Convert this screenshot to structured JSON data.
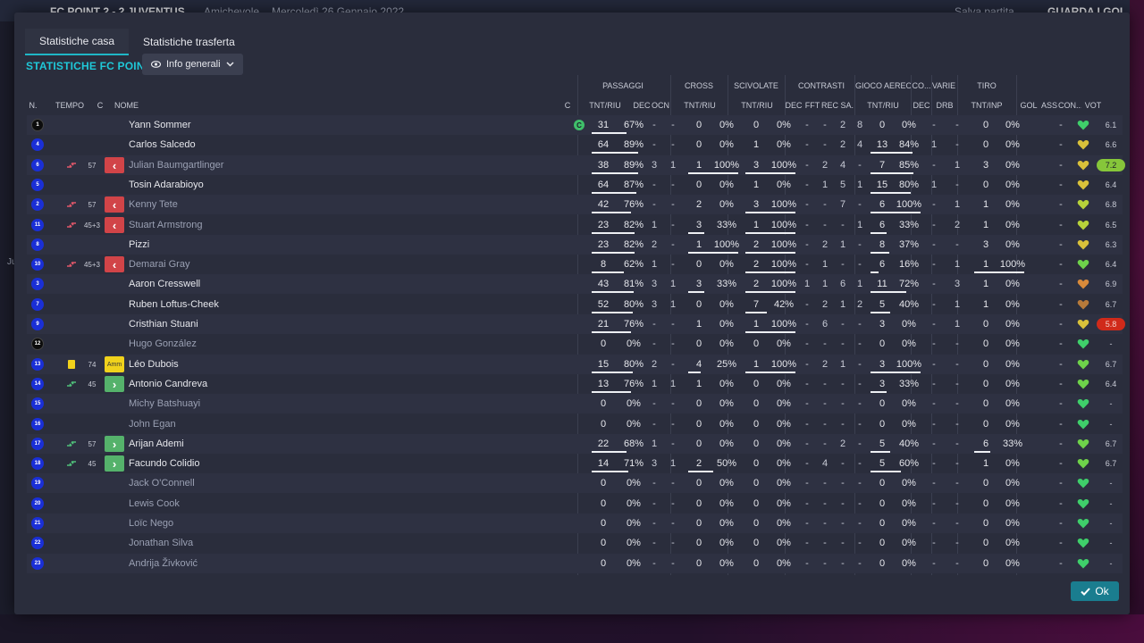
{
  "background": {
    "match": "FC POINT  2 - 2  JUVENTUS",
    "type": "Amichevole",
    "date": "Mercoledì 26 Gennaio 2022",
    "save": "Salva partita",
    "watch": "GUARDA I GOL",
    "side": "Ju"
  },
  "tabs": [
    {
      "label": "Statistiche casa"
    },
    {
      "label": "Statistiche trasferta"
    }
  ],
  "team_title": "STATISTICHE FC POINT",
  "info_btn": "Info generali",
  "headers": {
    "n": "N.",
    "tempo": "TEMPO",
    "c": "C",
    "nome": "NOME",
    "c2": "C",
    "passaggi": "PASSAGGI",
    "cross": "CROSS",
    "scivolate": "SCIVOLATE",
    "contrasti": "CONTRASTI",
    "gioco_aereo": "GIOCO AEREO",
    "co": "CO...",
    "varie": "VARIE",
    "tiro": "TIRO",
    "tnt_riu": "TNT/RIU",
    "dec": "DEC",
    "ocn": "OCN",
    "fft": "FFT",
    "rec_sa": "REC SA...",
    "drb": "DRB",
    "tnt_inp": "TNT/INP",
    "gol": "GOL",
    "ass": "ASS",
    "con": "CON...",
    "vot": "VOT"
  },
  "players": [
    {
      "n": "1",
      "gk": true,
      "name": "Yann Sommer",
      "dim": false,
      "mins": "",
      "sub": "",
      "role": "",
      "cap": true,
      "p": [
        "31",
        "67%"
      ],
      "pdec": "-",
      "pocn": "-",
      "cr": [
        "0",
        "0%"
      ],
      "sc": [
        "0",
        "0%"
      ],
      "ct": [
        "-",
        "-",
        "2",
        "8"
      ],
      "ga": [
        "0",
        "0%"
      ],
      "co": "-",
      "drb": "-",
      "tiro": [
        "0",
        "0%"
      ],
      "gol": "",
      "ass": "-",
      "vot": "6.1",
      "vcls": "",
      "heart": "#3fcf6a"
    },
    {
      "n": "4",
      "gk": false,
      "name": "Carlos Salcedo",
      "dim": false,
      "mins": "",
      "sub": "",
      "role": "",
      "cap": false,
      "p": [
        "64",
        "89%"
      ],
      "pdec": "-",
      "pocn": "-",
      "cr": [
        "0",
        "0%"
      ],
      "sc": [
        "1",
        "0%"
      ],
      "ct": [
        "-",
        "-",
        "2",
        "4"
      ],
      "ga": [
        "13",
        "84%"
      ],
      "co": "1",
      "drb": "-",
      "tiro": [
        "0",
        "0%"
      ],
      "gol": "",
      "ass": "-",
      "vot": "6.6",
      "vcls": "",
      "heart": "#d9c13a"
    },
    {
      "n": "6",
      "gk": false,
      "name": "Julian Baumgartlinger",
      "dim": true,
      "mins": "57",
      "sub": "out",
      "role": "out",
      "cap": false,
      "p": [
        "38",
        "89%"
      ],
      "pdec": "3",
      "pocn": "1",
      "cr": [
        "1",
        "100%"
      ],
      "sc": [
        "3",
        "100%"
      ],
      "ct": [
        "-",
        "2",
        "4",
        "-"
      ],
      "ga": [
        "7",
        "85%"
      ],
      "co": "-",
      "drb": "1",
      "tiro": [
        "3",
        "0%"
      ],
      "gol": "",
      "ass": "-",
      "vot": "7.2",
      "vcls": "good",
      "heart": "#d9c13a"
    },
    {
      "n": "5",
      "gk": false,
      "name": "Tosin Adarabioyo",
      "dim": false,
      "mins": "",
      "sub": "",
      "role": "",
      "cap": false,
      "p": [
        "64",
        "87%"
      ],
      "pdec": "-",
      "pocn": "-",
      "cr": [
        "0",
        "0%"
      ],
      "sc": [
        "1",
        "0%"
      ],
      "ct": [
        "-",
        "1",
        "5",
        "1"
      ],
      "ga": [
        "15",
        "80%"
      ],
      "co": "1",
      "drb": "-",
      "tiro": [
        "0",
        "0%"
      ],
      "gol": "",
      "ass": "-",
      "vot": "6.4",
      "vcls": "",
      "heart": "#d9c13a"
    },
    {
      "n": "2",
      "gk": false,
      "name": "Kenny Tete",
      "dim": true,
      "mins": "57",
      "sub": "out",
      "role": "out",
      "cap": false,
      "p": [
        "42",
        "76%"
      ],
      "pdec": "-",
      "pocn": "-",
      "cr": [
        "2",
        "0%"
      ],
      "sc": [
        "3",
        "100%"
      ],
      "ct": [
        "-",
        "-",
        "7",
        "-"
      ],
      "ga": [
        "6",
        "100%"
      ],
      "co": "-",
      "drb": "1",
      "tiro": [
        "1",
        "0%"
      ],
      "gol": "",
      "ass": "-",
      "vot": "6.8",
      "vcls": "",
      "heart": "#b7d23a"
    },
    {
      "n": "11",
      "gk": false,
      "name": "Stuart Armstrong",
      "dim": true,
      "mins": "45+3",
      "sub": "out",
      "role": "out",
      "cap": false,
      "p": [
        "23",
        "82%"
      ],
      "pdec": "1",
      "pocn": "-",
      "cr": [
        "3",
        "33%"
      ],
      "sc": [
        "1",
        "100%"
      ],
      "ct": [
        "-",
        "-",
        "-",
        "1"
      ],
      "ga": [
        "6",
        "33%"
      ],
      "co": "-",
      "drb": "2",
      "tiro": [
        "1",
        "0%"
      ],
      "gol": "",
      "ass": "-",
      "vot": "6.5",
      "vcls": "",
      "heart": "#b7d23a"
    },
    {
      "n": "8",
      "gk": false,
      "name": "Pizzi",
      "dim": false,
      "mins": "",
      "sub": "",
      "role": "",
      "cap": false,
      "p": [
        "23",
        "82%"
      ],
      "pdec": "2",
      "pocn": "-",
      "cr": [
        "1",
        "100%"
      ],
      "sc": [
        "2",
        "100%"
      ],
      "ct": [
        "-",
        "2",
        "1",
        "-"
      ],
      "ga": [
        "8",
        "37%"
      ],
      "co": "-",
      "drb": "-",
      "tiro": [
        "3",
        "0%"
      ],
      "gol": "",
      "ass": "-",
      "vot": "6.3",
      "vcls": "",
      "heart": "#d9c13a"
    },
    {
      "n": "10",
      "gk": false,
      "name": "Demarai Gray",
      "dim": true,
      "mins": "45+3",
      "sub": "out",
      "role": "out",
      "cap": false,
      "p": [
        "8",
        "62%"
      ],
      "pdec": "1",
      "pocn": "-",
      "cr": [
        "0",
        "0%"
      ],
      "sc": [
        "2",
        "100%"
      ],
      "ct": [
        "-",
        "1",
        "-",
        "-"
      ],
      "ga": [
        "6",
        "16%"
      ],
      "co": "-",
      "drb": "1",
      "tiro": [
        "1",
        "100%"
      ],
      "gol": "",
      "ass": "-",
      "vot": "6.4",
      "vcls": "",
      "heart": "#6ed24a"
    },
    {
      "n": "3",
      "gk": false,
      "name": "Aaron Cresswell",
      "dim": false,
      "mins": "",
      "sub": "",
      "role": "",
      "cap": false,
      "p": [
        "43",
        "81%"
      ],
      "pdec": "3",
      "pocn": "1",
      "cr": [
        "3",
        "33%"
      ],
      "sc": [
        "2",
        "100%"
      ],
      "ct": [
        "1",
        "1",
        "6",
        "1"
      ],
      "ga": [
        "11",
        "72%"
      ],
      "co": "-",
      "drb": "3",
      "tiro": [
        "1",
        "0%"
      ],
      "gol": "",
      "ass": "-",
      "vot": "6.9",
      "vcls": "",
      "heart": "#d98a3a"
    },
    {
      "n": "7",
      "gk": false,
      "name": "Ruben Loftus-Cheek",
      "dim": false,
      "mins": "",
      "sub": "",
      "role": "",
      "cap": false,
      "p": [
        "52",
        "80%"
      ],
      "pdec": "3",
      "pocn": "1",
      "cr": [
        "0",
        "0%"
      ],
      "sc": [
        "7",
        "42%"
      ],
      "ct": [
        "-",
        "2",
        "1",
        "2"
      ],
      "ga": [
        "5",
        "40%"
      ],
      "co": "-",
      "drb": "1",
      "tiro": [
        "1",
        "0%"
      ],
      "gol": "",
      "ass": "-",
      "vot": "6.7",
      "vcls": "",
      "heart": "#b77a3a"
    },
    {
      "n": "9",
      "gk": false,
      "name": "Cristhian Stuani",
      "dim": false,
      "mins": "",
      "sub": "",
      "role": "",
      "cap": false,
      "p": [
        "21",
        "76%"
      ],
      "pdec": "-",
      "pocn": "-",
      "cr": [
        "1",
        "0%"
      ],
      "sc": [
        "1",
        "100%"
      ],
      "ct": [
        "-",
        "6",
        "-",
        "-"
      ],
      "ga": [
        "3",
        "0%"
      ],
      "co": "-",
      "drb": "1",
      "tiro": [
        "0",
        "0%"
      ],
      "gol": "",
      "ass": "-",
      "vot": "5.8",
      "vcls": "bad",
      "heart": "#d9c13a"
    },
    {
      "n": "12",
      "gk": true,
      "name": "Hugo González",
      "dim": true,
      "mins": "",
      "sub": "",
      "role": "",
      "cap": false,
      "p": [
        "0",
        "0%"
      ],
      "pdec": "-",
      "pocn": "-",
      "cr": [
        "0",
        "0%"
      ],
      "sc": [
        "0",
        "0%"
      ],
      "ct": [
        "-",
        "-",
        "-",
        "-"
      ],
      "ga": [
        "0",
        "0%"
      ],
      "co": "-",
      "drb": "-",
      "tiro": [
        "0",
        "0%"
      ],
      "gol": "",
      "ass": "-",
      "vot": "-",
      "vcls": "",
      "heart": "#3fcf6a"
    },
    {
      "n": "13",
      "gk": false,
      "name": "Léo Dubois",
      "dim": false,
      "mins": "74",
      "sub": "yellow",
      "role": "amm",
      "cap": false,
      "p": [
        "15",
        "80%"
      ],
      "pdec": "2",
      "pocn": "-",
      "cr": [
        "4",
        "25%"
      ],
      "sc": [
        "1",
        "100%"
      ],
      "ct": [
        "-",
        "2",
        "1",
        "-"
      ],
      "ga": [
        "3",
        "100%"
      ],
      "co": "-",
      "drb": "-",
      "tiro": [
        "0",
        "0%"
      ],
      "gol": "",
      "ass": "-",
      "vot": "6.7",
      "vcls": "",
      "heart": "#6ed24a"
    },
    {
      "n": "14",
      "gk": false,
      "name": "Antonio Candreva",
      "dim": false,
      "mins": "45",
      "sub": "in",
      "role": "in",
      "cap": false,
      "p": [
        "13",
        "76%"
      ],
      "pdec": "1",
      "pocn": "1",
      "cr": [
        "1",
        "0%"
      ],
      "sc": [
        "0",
        "0%"
      ],
      "ct": [
        "-",
        "-",
        "-",
        "-"
      ],
      "ga": [
        "3",
        "33%"
      ],
      "co": "-",
      "drb": "-",
      "tiro": [
        "0",
        "0%"
      ],
      "gol": "",
      "ass": "-",
      "vot": "6.4",
      "vcls": "",
      "heart": "#6ed24a"
    },
    {
      "n": "15",
      "gk": false,
      "name": "Michy Batshuayi",
      "dim": true,
      "mins": "",
      "sub": "",
      "role": "",
      "cap": false,
      "p": [
        "0",
        "0%"
      ],
      "pdec": "-",
      "pocn": "-",
      "cr": [
        "0",
        "0%"
      ],
      "sc": [
        "0",
        "0%"
      ],
      "ct": [
        "-",
        "-",
        "-",
        "-"
      ],
      "ga": [
        "0",
        "0%"
      ],
      "co": "-",
      "drb": "-",
      "tiro": [
        "0",
        "0%"
      ],
      "gol": "",
      "ass": "-",
      "vot": "-",
      "vcls": "",
      "heart": "#3fcf6a"
    },
    {
      "n": "16",
      "gk": false,
      "name": "John Egan",
      "dim": true,
      "mins": "",
      "sub": "",
      "role": "",
      "cap": false,
      "p": [
        "0",
        "0%"
      ],
      "pdec": "-",
      "pocn": "-",
      "cr": [
        "0",
        "0%"
      ],
      "sc": [
        "0",
        "0%"
      ],
      "ct": [
        "-",
        "-",
        "-",
        "-"
      ],
      "ga": [
        "0",
        "0%"
      ],
      "co": "-",
      "drb": "-",
      "tiro": [
        "0",
        "0%"
      ],
      "gol": "",
      "ass": "-",
      "vot": "-",
      "vcls": "",
      "heart": "#3fcf6a"
    },
    {
      "n": "17",
      "gk": false,
      "name": "Arijan Ademi",
      "dim": false,
      "mins": "57",
      "sub": "in",
      "role": "in",
      "cap": false,
      "p": [
        "22",
        "68%"
      ],
      "pdec": "1",
      "pocn": "-",
      "cr": [
        "0",
        "0%"
      ],
      "sc": [
        "0",
        "0%"
      ],
      "ct": [
        "-",
        "-",
        "2",
        "-"
      ],
      "ga": [
        "5",
        "40%"
      ],
      "co": "-",
      "drb": "-",
      "tiro": [
        "6",
        "33%"
      ],
      "gol": "",
      "ass": "-",
      "vot": "6.7",
      "vcls": "",
      "heart": "#6ed24a"
    },
    {
      "n": "18",
      "gk": false,
      "name": "Facundo Colidio",
      "dim": false,
      "mins": "45",
      "sub": "in",
      "role": "in",
      "cap": false,
      "p": [
        "14",
        "71%"
      ],
      "pdec": "3",
      "pocn": "1",
      "cr": [
        "2",
        "50%"
      ],
      "sc": [
        "0",
        "0%"
      ],
      "ct": [
        "-",
        "4",
        "-",
        "-"
      ],
      "ga": [
        "5",
        "60%"
      ],
      "co": "-",
      "drb": "-",
      "tiro": [
        "1",
        "0%"
      ],
      "gol": "",
      "ass": "-",
      "vot": "6.7",
      "vcls": "",
      "heart": "#6ed24a"
    },
    {
      "n": "19",
      "gk": false,
      "name": "Jack O'Connell",
      "dim": true,
      "mins": "",
      "sub": "",
      "role": "",
      "cap": false,
      "p": [
        "0",
        "0%"
      ],
      "pdec": "-",
      "pocn": "-",
      "cr": [
        "0",
        "0%"
      ],
      "sc": [
        "0",
        "0%"
      ],
      "ct": [
        "-",
        "-",
        "-",
        "-"
      ],
      "ga": [
        "0",
        "0%"
      ],
      "co": "-",
      "drb": "-",
      "tiro": [
        "0",
        "0%"
      ],
      "gol": "",
      "ass": "-",
      "vot": "-",
      "vcls": "",
      "heart": "#3fcf6a"
    },
    {
      "n": "20",
      "gk": false,
      "name": "Lewis Cook",
      "dim": true,
      "mins": "",
      "sub": "",
      "role": "",
      "cap": false,
      "p": [
        "0",
        "0%"
      ],
      "pdec": "-",
      "pocn": "-",
      "cr": [
        "0",
        "0%"
      ],
      "sc": [
        "0",
        "0%"
      ],
      "ct": [
        "-",
        "-",
        "-",
        "-"
      ],
      "ga": [
        "0",
        "0%"
      ],
      "co": "-",
      "drb": "-",
      "tiro": [
        "0",
        "0%"
      ],
      "gol": "",
      "ass": "-",
      "vot": "-",
      "vcls": "",
      "heart": "#3fcf6a"
    },
    {
      "n": "21",
      "gk": false,
      "name": "Loïc Nego",
      "dim": true,
      "mins": "",
      "sub": "",
      "role": "",
      "cap": false,
      "p": [
        "0",
        "0%"
      ],
      "pdec": "-",
      "pocn": "-",
      "cr": [
        "0",
        "0%"
      ],
      "sc": [
        "0",
        "0%"
      ],
      "ct": [
        "-",
        "-",
        "-",
        "-"
      ],
      "ga": [
        "0",
        "0%"
      ],
      "co": "-",
      "drb": "-",
      "tiro": [
        "0",
        "0%"
      ],
      "gol": "",
      "ass": "-",
      "vot": "-",
      "vcls": "",
      "heart": "#3fcf6a"
    },
    {
      "n": "22",
      "gk": false,
      "name": "Jonathan Silva",
      "dim": true,
      "mins": "",
      "sub": "",
      "role": "",
      "cap": false,
      "p": [
        "0",
        "0%"
      ],
      "pdec": "-",
      "pocn": "-",
      "cr": [
        "0",
        "0%"
      ],
      "sc": [
        "0",
        "0%"
      ],
      "ct": [
        "-",
        "-",
        "-",
        "-"
      ],
      "ga": [
        "0",
        "0%"
      ],
      "co": "-",
      "drb": "-",
      "tiro": [
        "0",
        "0%"
      ],
      "gol": "",
      "ass": "-",
      "vot": "-",
      "vcls": "",
      "heart": "#3fcf6a"
    },
    {
      "n": "23",
      "gk": false,
      "name": "Andrija Živković",
      "dim": true,
      "mins": "",
      "sub": "",
      "role": "",
      "cap": false,
      "p": [
        "0",
        "0%"
      ],
      "pdec": "-",
      "pocn": "-",
      "cr": [
        "0",
        "0%"
      ],
      "sc": [
        "0",
        "0%"
      ],
      "ct": [
        "-",
        "-",
        "-",
        "-"
      ],
      "ga": [
        "0",
        "0%"
      ],
      "co": "-",
      "drb": "-",
      "tiro": [
        "0",
        "0%"
      ],
      "gol": "",
      "ass": "-",
      "vot": "-",
      "vcls": "",
      "heart": "#3fcf6a"
    }
  ],
  "ok_label": "Ok"
}
